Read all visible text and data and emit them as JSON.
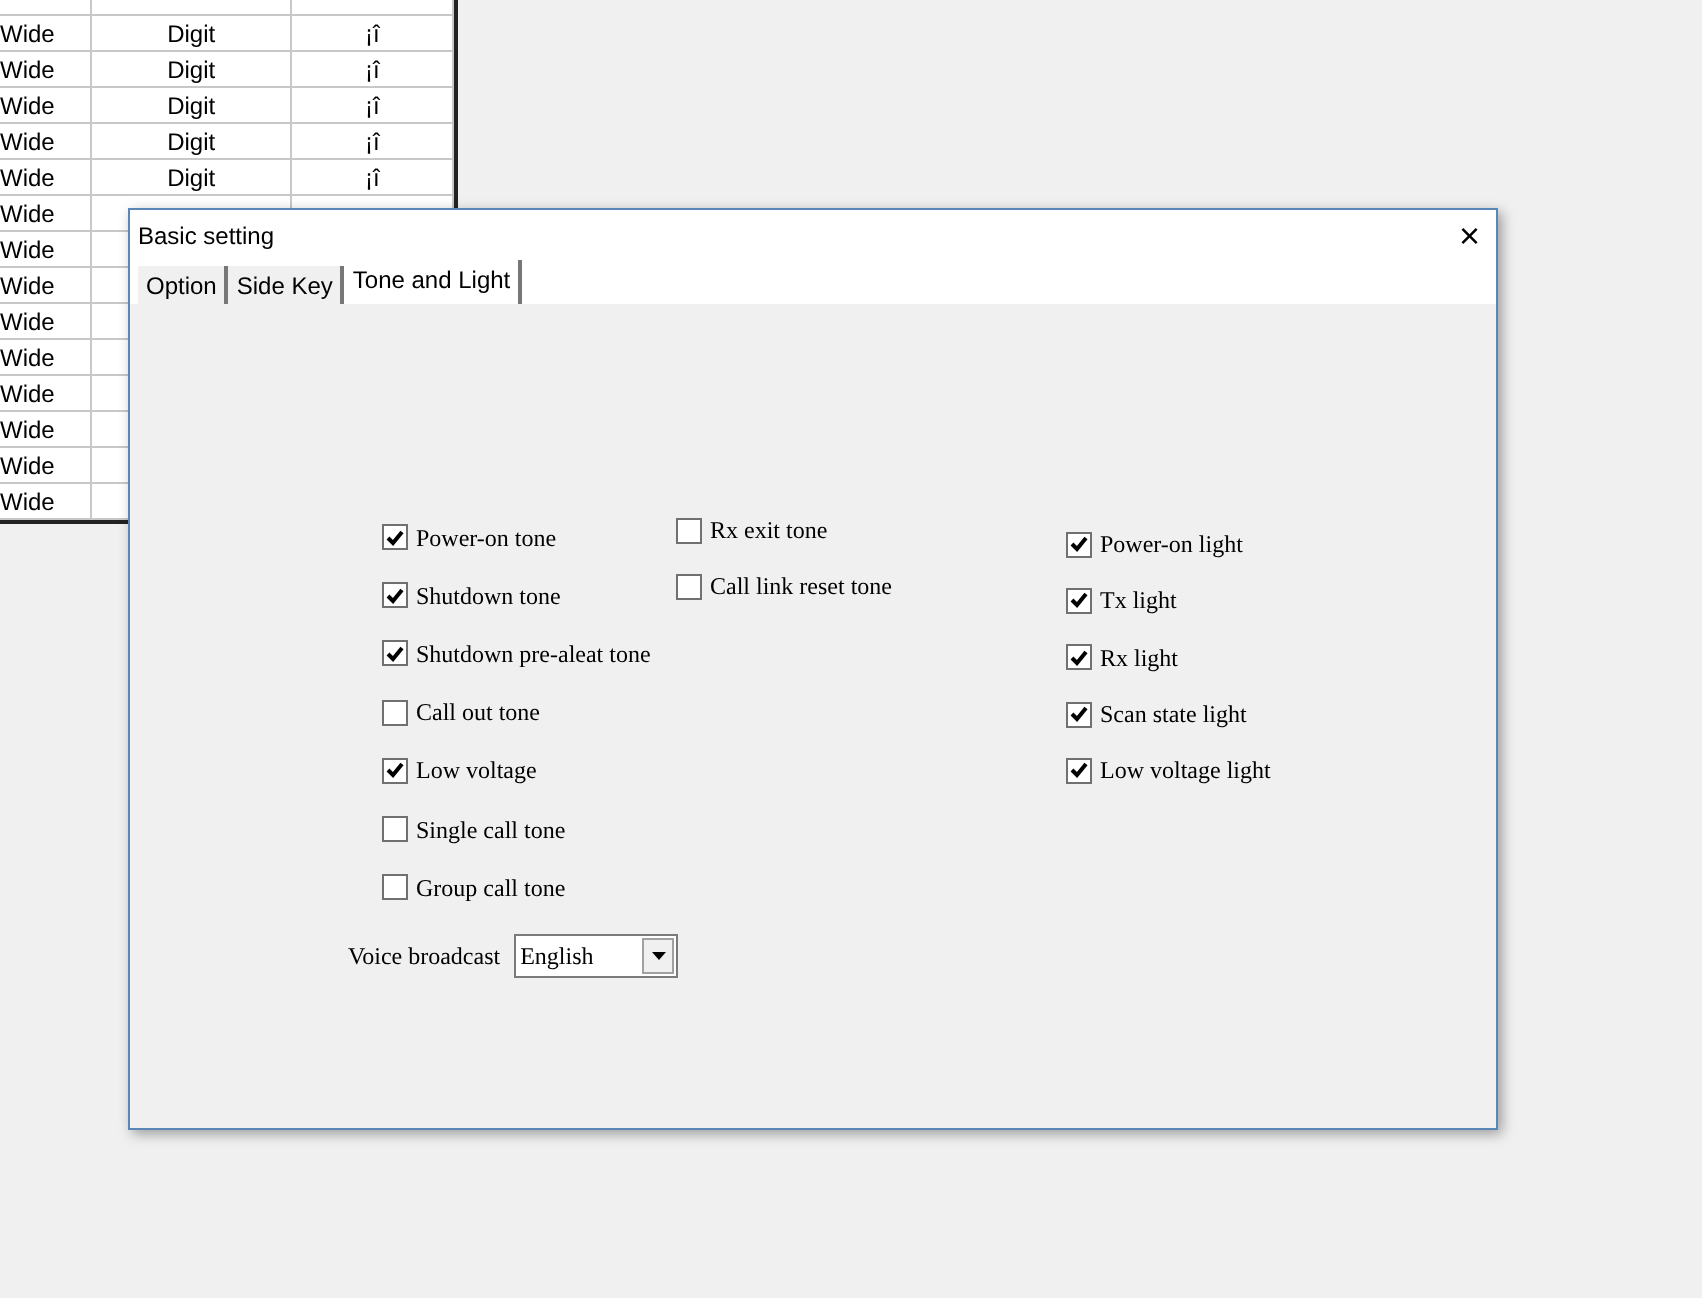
{
  "background_table": {
    "rows": [
      {
        "cells": [
          "Wide",
          "Digit",
          "¡î"
        ]
      },
      {
        "cells": [
          "Wide",
          "Digit",
          "¡î"
        ]
      },
      {
        "cells": [
          "Wide",
          "Digit",
          "¡î"
        ]
      },
      {
        "cells": [
          "Wide",
          "Digit",
          "¡î"
        ]
      },
      {
        "cells": [
          "Wide",
          "Digit",
          "¡î"
        ]
      },
      {
        "cells": [
          "Wide"
        ]
      },
      {
        "cells": [
          "Wide"
        ]
      },
      {
        "cells": [
          "Wide"
        ]
      },
      {
        "cells": [
          "Wide"
        ]
      },
      {
        "cells": [
          "Wide"
        ]
      },
      {
        "cells": [
          "Wide"
        ]
      },
      {
        "cells": [
          "Wide"
        ]
      },
      {
        "cells": [
          "Wide"
        ]
      },
      {
        "cells": [
          "Wide"
        ]
      }
    ]
  },
  "window": {
    "title": "Basic setting",
    "close": "×"
  },
  "tabs": [
    {
      "label": "Option",
      "selected": false
    },
    {
      "label": "Side Key",
      "selected": false
    },
    {
      "label": "Tone and Light",
      "selected": true
    }
  ],
  "tone_options": [
    {
      "label": "Power-on tone",
      "checked": true
    },
    {
      "label": "Shutdown tone",
      "checked": true
    },
    {
      "label": "Shutdown pre-aleat tone",
      "checked": true
    },
    {
      "label": "Call out tone",
      "checked": false
    },
    {
      "label": "Low voltage",
      "checked": true
    },
    {
      "label": "Single call tone",
      "checked": false
    },
    {
      "label": "Group call tone",
      "checked": false
    }
  ],
  "extra_tone_options": [
    {
      "label": "Rx exit tone",
      "checked": false
    },
    {
      "label": "Call link reset tone",
      "checked": false
    }
  ],
  "light_options": [
    {
      "label": "Power-on light",
      "checked": true
    },
    {
      "label": "Tx light",
      "checked": true
    },
    {
      "label": "Rx light",
      "checked": true
    },
    {
      "label": "Scan state light",
      "checked": true
    },
    {
      "label": "Low voltage light",
      "checked": true
    }
  ],
  "voice_broadcast": {
    "label": "Voice broadcast",
    "value": "English"
  }
}
